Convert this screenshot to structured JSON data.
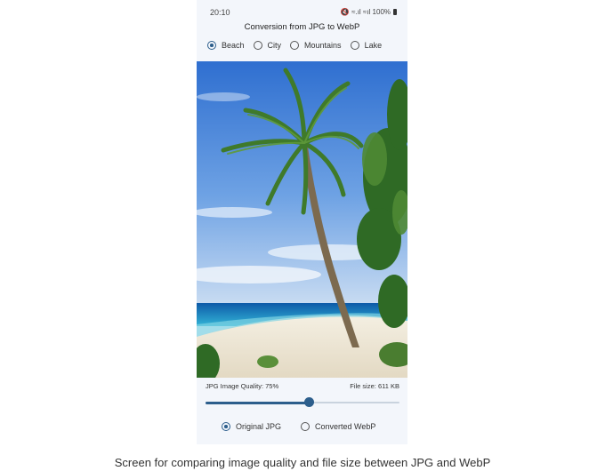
{
  "status_bar": {
    "time": "20:10",
    "icons_text": "🔇 ≈.ıl ≈ıl 100%",
    "battery_icon": "battery-icon"
  },
  "app": {
    "title": "Conversion from JPG to WebP"
  },
  "scene_options": [
    {
      "label": "Beach",
      "selected": true
    },
    {
      "label": "City",
      "selected": false
    },
    {
      "label": "Mountains",
      "selected": false
    },
    {
      "label": "Lake",
      "selected": false
    }
  ],
  "image": {
    "description_name": "beach-palm-photo"
  },
  "quality": {
    "label": "JPG Image Quality: 75%",
    "value_percent": 75
  },
  "file_size": {
    "label": "File size: 611 KB"
  },
  "format_options": [
    {
      "label": "Original JPG",
      "selected": true
    },
    {
      "label": "Converted WebP",
      "selected": false
    }
  ],
  "caption": "Screen for comparing image quality and file size between JPG and WebP",
  "colors": {
    "accent": "#2c5e8c",
    "phone_bg": "#f3f6fb"
  }
}
